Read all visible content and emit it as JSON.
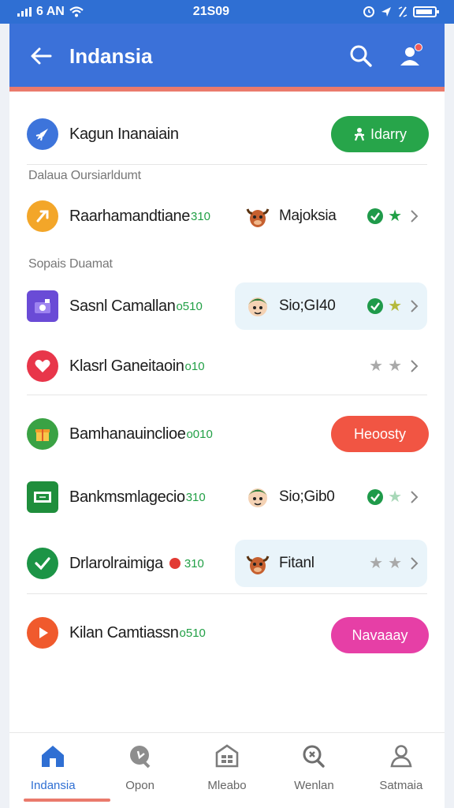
{
  "status_bar": {
    "carrier_time": "6 AN",
    "center_time": "21S09"
  },
  "header": {
    "title": "Indansia"
  },
  "colors": {
    "primary": "#3b71d9",
    "accent": "#ea7a6c",
    "green": "#27a54a",
    "red": "#f15543",
    "pink": "#e63fa6"
  },
  "top_item": {
    "label": "Kagun Inanaiain",
    "button": "Idarry",
    "icon": "rocket-icon"
  },
  "sections": [
    "Dalaua Oursiarldumt",
    "Sopais Duamat"
  ],
  "rows": [
    {
      "label": "Raarhamandtiane",
      "tag": "310",
      "icon": "bolt-icon",
      "partner": "Majoksia",
      "partner_avatar": "bull-avatar"
    },
    {
      "label": "Sasnl Camallan",
      "tag": "o510",
      "icon": "camera-icon",
      "partner": "Sio;GI40",
      "partner_avatar": "kid-avatar"
    },
    {
      "label": "Klasrl Ganeitaoin",
      "tag": "o10",
      "icon": "heart-icon"
    },
    {
      "label": "Bamhanauinclioe",
      "tag": "o010",
      "icon": "gift-icon",
      "button": "Heoosty"
    },
    {
      "label": "Bankmsmlagecio",
      "tag": "310",
      "icon": "card-icon",
      "partner": "Sio;Gib0",
      "partner_avatar": "kid-avatar"
    },
    {
      "label": "Drlarolraimiga",
      "tag": "310",
      "icon": "check-circle-icon",
      "partner": "Fitanl",
      "partner_avatar": "bull-avatar"
    },
    {
      "label": "Kilan Camtiassn",
      "tag": "o510",
      "icon": "play-icon",
      "button": "Navaaay"
    }
  ],
  "nav": [
    {
      "label": "Indansia",
      "icon": "home-icon"
    },
    {
      "label": "Opon",
      "icon": "chat-icon"
    },
    {
      "label": "Mleabo",
      "icon": "building-icon"
    },
    {
      "label": "Wenlan",
      "icon": "refresh-icon"
    },
    {
      "label": "Satmaia",
      "icon": "user-icon"
    }
  ]
}
